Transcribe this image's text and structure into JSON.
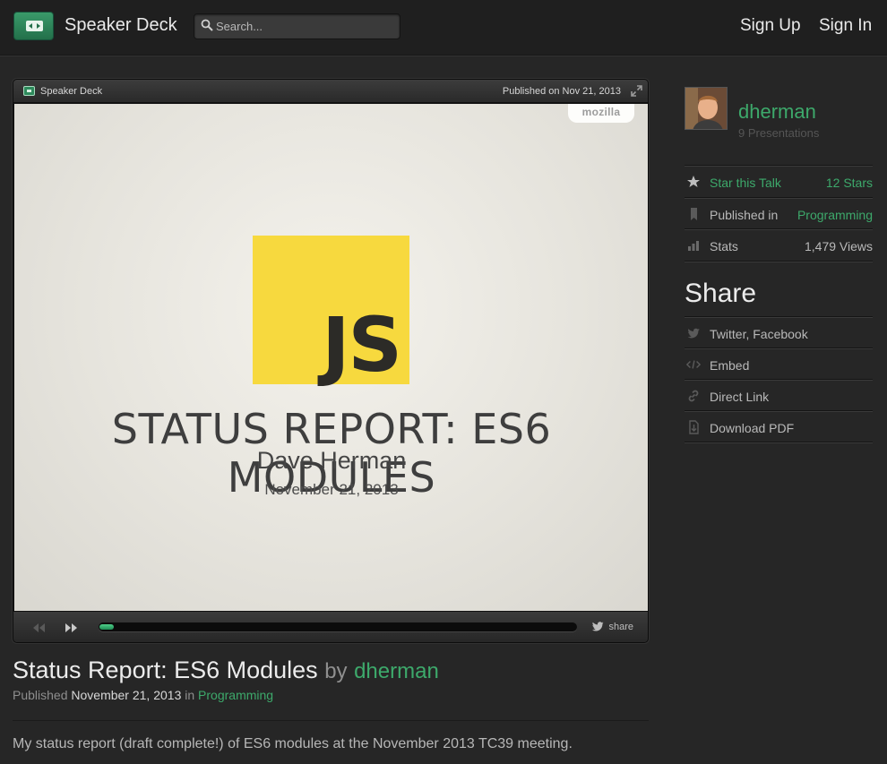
{
  "header": {
    "brand": "Speaker Deck",
    "search_placeholder": "Search...",
    "signup": "Sign Up",
    "signin": "Sign In"
  },
  "player": {
    "brand": "Speaker Deck",
    "published": "Published on Nov 21, 2013",
    "slide": {
      "badge": "mozilla",
      "logo_text": "JS",
      "title": "STATUS REPORT: ES6 MODULES",
      "author": "Dave Herman",
      "date": "November 21, 2013"
    },
    "progress_fraction": 0.03,
    "share_label": "share"
  },
  "talk": {
    "title": "Status Report: ES6 Modules",
    "by": "by",
    "author": "dherman",
    "published_label": "Published",
    "published_date": "November 21, 2013",
    "in_label": "in",
    "category": "Programming",
    "description": "My status report (draft complete!) of ES6 modules at the November 2013 TC39 meeting."
  },
  "sidebar": {
    "author": "dherman",
    "presentations": "9 Presentations",
    "star_label": "Star this Talk",
    "stars": "12 Stars",
    "published_in_label": "Published in",
    "published_in": "Programming",
    "stats_label": "Stats",
    "views": "1,479 Views",
    "share_heading": "Share",
    "share_items": [
      "Twitter, Facebook",
      "Embed",
      "Direct Link",
      "Download PDF"
    ]
  },
  "colors": {
    "accent": "#3da96b",
    "background": "#262626",
    "js_yellow": "#f7d93e"
  }
}
